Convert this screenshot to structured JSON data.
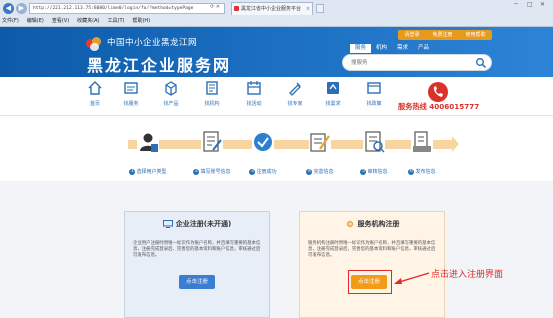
{
  "browser": {
    "address": "http://221.212.113.75:8080/lime0/login/fo/?method=typePage",
    "tab_title": "黑龙江省中小企业服务平台",
    "tab_close": "×",
    "nav_back": "◀",
    "nav_fwd": "▶",
    "menu": [
      "文件(F)",
      "编辑(E)",
      "查看(V)",
      "收藏夹(A)",
      "工具(T)",
      "帮助(H)"
    ],
    "window_controls": [
      "─",
      "□",
      "✕"
    ]
  },
  "header": {
    "subtitle": "中国中小企业黑龙江网",
    "title": "黑龙江企业服务网",
    "top_links": [
      "请登录",
      "免费注册",
      "使用帮助"
    ],
    "search_tabs": [
      "服务",
      "机构",
      "需求",
      "产品"
    ],
    "search_placeholder": "搜服务"
  },
  "nav": {
    "items": [
      {
        "label": "首页",
        "icon": "home-icon"
      },
      {
        "label": "找服务",
        "icon": "service-icon"
      },
      {
        "label": "找产品",
        "icon": "product-icon"
      },
      {
        "label": "找机构",
        "icon": "institution-icon"
      },
      {
        "label": "找活动",
        "icon": "activity-icon"
      },
      {
        "label": "找专家",
        "icon": "expert-icon"
      },
      {
        "label": "找需求",
        "icon": "demand-icon"
      },
      {
        "label": "找政策",
        "icon": "policy-icon"
      }
    ],
    "hotline_label": "服务热线",
    "hotline_number": "4006015777"
  },
  "steps": [
    {
      "num": "1",
      "label": "选择用户类型"
    },
    {
      "num": "2",
      "label": "填写账号信息"
    },
    {
      "num": "3",
      "label": "注册成功"
    },
    {
      "num": "4",
      "label": "完善信息"
    },
    {
      "num": "5",
      "label": "审核信息"
    },
    {
      "num": "6",
      "label": "发布信息"
    }
  ],
  "cards": {
    "enterprise": {
      "title": "企业注册(未开通)",
      "desc": "企业用户注册时用唯一标识作为账户名称，并且填写重要的基本信息，注册完成登录后，完善您的基本资料和账户信息，审核通过后可发布信息。",
      "button": "点击注册"
    },
    "institution": {
      "title": "服务机构注册",
      "desc": "服务机构注册时用唯一标识作为账户名称，并且填写重要的基本信息，注册完成登录后，完善您的基本资料和账户信息，审核通过后可发布信息。",
      "button": "点击注册"
    }
  },
  "annotation": "点击进入注册界面",
  "colors": {
    "brand_blue": "#1a6dbf",
    "accent_orange": "#f29b16",
    "alert_red": "#e02a2a"
  }
}
